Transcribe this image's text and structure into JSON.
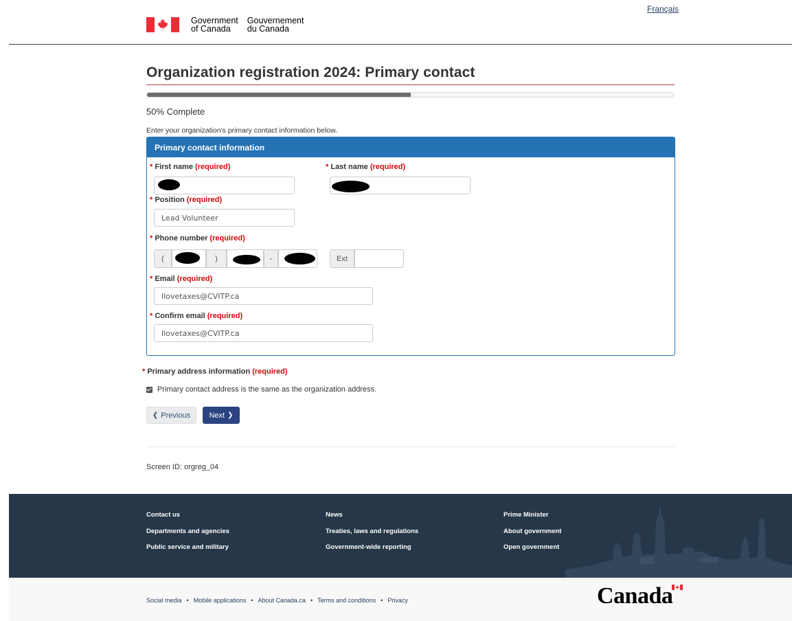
{
  "header": {
    "language_link": "Français",
    "gov_en": "Government\nof Canada",
    "gov_fr": "Gouvernement\ndu Canada"
  },
  "page": {
    "title": "Organization registration 2024: Primary contact",
    "progress_percent": 50,
    "progress_text": "50% Complete",
    "intro": "Enter your organization's primary contact information below."
  },
  "panel": {
    "heading": "Primary contact information",
    "required_marker": "*",
    "required_text": "(required)",
    "first_name": {
      "label": "First name",
      "value": ""
    },
    "last_name": {
      "label": "Last name",
      "value": ""
    },
    "position": {
      "label": "Position",
      "value": "Lead Volunteer"
    },
    "phone": {
      "label": "Phone number",
      "open_paren": "(",
      "close_paren": ")",
      "dash": "-",
      "ext_label": "Ext",
      "ext_value": ""
    },
    "email": {
      "label": "Email",
      "value": "Ilovetaxes@CVITP.ca"
    },
    "confirm_email": {
      "label": "Confirm email",
      "value": "Ilovetaxes@CVITP.ca"
    }
  },
  "address": {
    "label": "Primary address information",
    "checkbox_label": "Primary contact address is the same as the organization address.",
    "checked": true
  },
  "buttons": {
    "previous": "Previous",
    "next": "Next"
  },
  "screen_id": "Screen ID: orgreg_04",
  "footer": {
    "col1": [
      "Contact us",
      "Departments and agencies",
      "Public service and military"
    ],
    "col2": [
      "News",
      "Treaties, laws and regulations",
      "Government-wide reporting"
    ],
    "col3": [
      "Prime Minister",
      "About government",
      "Open government"
    ],
    "sub_links": [
      "Social media",
      "Mobile applications",
      "About Canada.ca",
      "Terms and conditions",
      "Privacy"
    ],
    "separator": "•",
    "wordmark": "Canada"
  },
  "colors": {
    "panel_blue": "#2572b4",
    "required_red": "#d3080c",
    "footer_navy": "#26374a",
    "next_button": "#2b4380",
    "flag_red": "#eb2d37"
  }
}
